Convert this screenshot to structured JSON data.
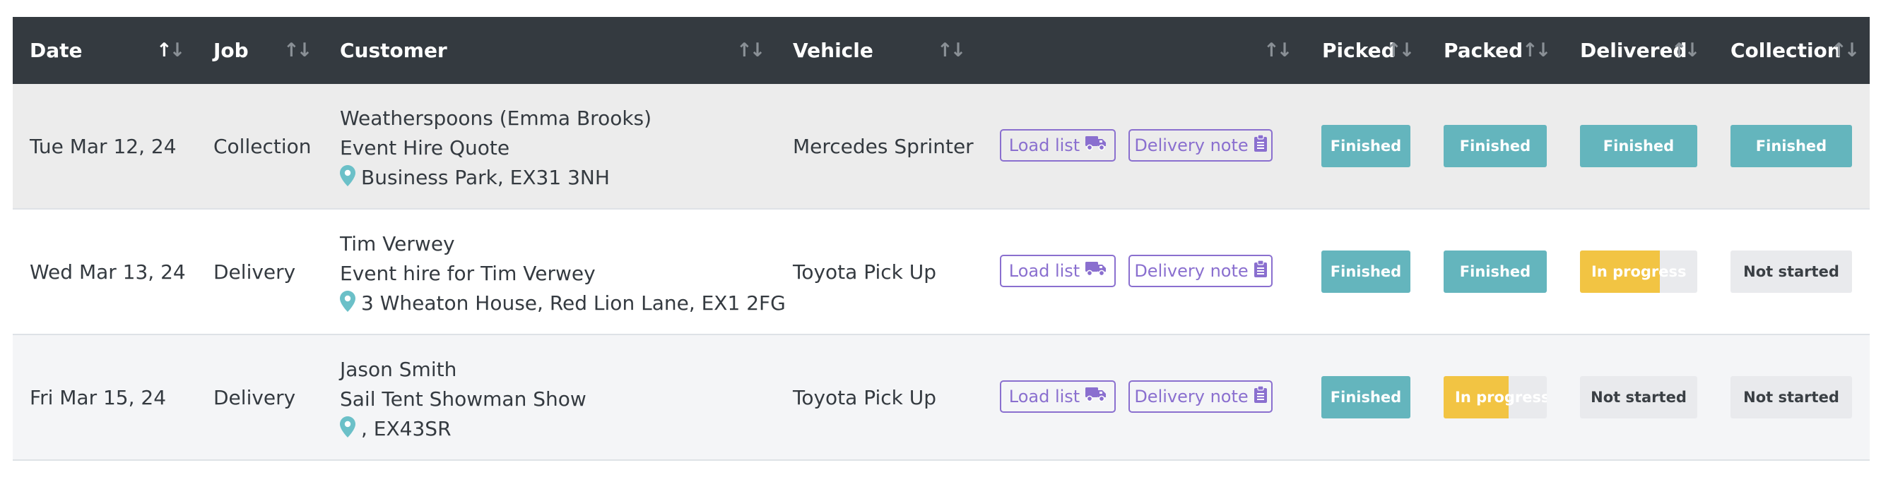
{
  "header": {
    "columns": [
      {
        "key": "date",
        "label": "Date"
      },
      {
        "key": "job",
        "label": "Job"
      },
      {
        "key": "customer",
        "label": "Customer"
      },
      {
        "key": "vehicle",
        "label": "Vehicle"
      },
      {
        "key": "actions",
        "label": ""
      },
      {
        "key": "picked",
        "label": "Picked"
      },
      {
        "key": "packed",
        "label": "Packed"
      },
      {
        "key": "delivered",
        "label": "Delivered"
      },
      {
        "key": "collection",
        "label": "Collection"
      }
    ],
    "sort_up_glyph": "↑",
    "sort_down_glyph": "↓",
    "active_sort_column": "date"
  },
  "buttons": {
    "load_list": "Load list",
    "delivery_note": "Delivery note"
  },
  "icons": {
    "load_list_icon": "truck-icon",
    "delivery_note_icon": "clipboard-icon",
    "address_icon": "map-marker-icon"
  },
  "colors": {
    "header_bg": "#343a40",
    "finished": "#64b5bd",
    "in_progress": "#f2c443",
    "not_started": "#e9eaed",
    "outline_button": "#8a6fcf",
    "pin": "#6bc0c8"
  },
  "rows": [
    {
      "date": "Tue Mar 12, 24",
      "job": "Collection",
      "customer_name": "Weatherspoons (Emma Brooks)",
      "quote": "Event Hire Quote",
      "address": "Business Park, EX31 3NH",
      "vehicle": "Mercedes Sprinter",
      "picked": {
        "label": "Finished",
        "state": "finished"
      },
      "packed": {
        "label": "Finished",
        "state": "finished"
      },
      "delivered": {
        "label": "Finished",
        "state": "finished"
      },
      "collection": {
        "label": "Finished",
        "state": "finished"
      }
    },
    {
      "date": "Wed Mar 13, 24",
      "job": "Delivery",
      "customer_name": "Tim Verwey",
      "quote": "Event hire for Tim Verwey",
      "address": "3 Wheaton House, Red Lion Lane, EX1 2FG",
      "vehicle": "Toyota Pick Up",
      "picked": {
        "label": "Finished",
        "state": "finished"
      },
      "packed": {
        "label": "Finished",
        "state": "finished"
      },
      "delivered": {
        "label": "In progress",
        "state": "progress",
        "progress": 0.68
      },
      "collection": {
        "label": "Not started",
        "state": "notstarted"
      }
    },
    {
      "date": "Fri Mar 15, 24",
      "job": "Delivery",
      "customer_name": "Jason Smith",
      "quote": "Sail Tent Showman Show",
      "address": ", EX43SR",
      "vehicle": "Toyota Pick Up",
      "picked": {
        "label": "Finished",
        "state": "finished"
      },
      "packed": {
        "label": "In progress",
        "state": "progress",
        "progress": 0.63
      },
      "delivered": {
        "label": "Not started",
        "state": "notstarted"
      },
      "collection": {
        "label": "Not started",
        "state": "notstarted"
      }
    }
  ]
}
